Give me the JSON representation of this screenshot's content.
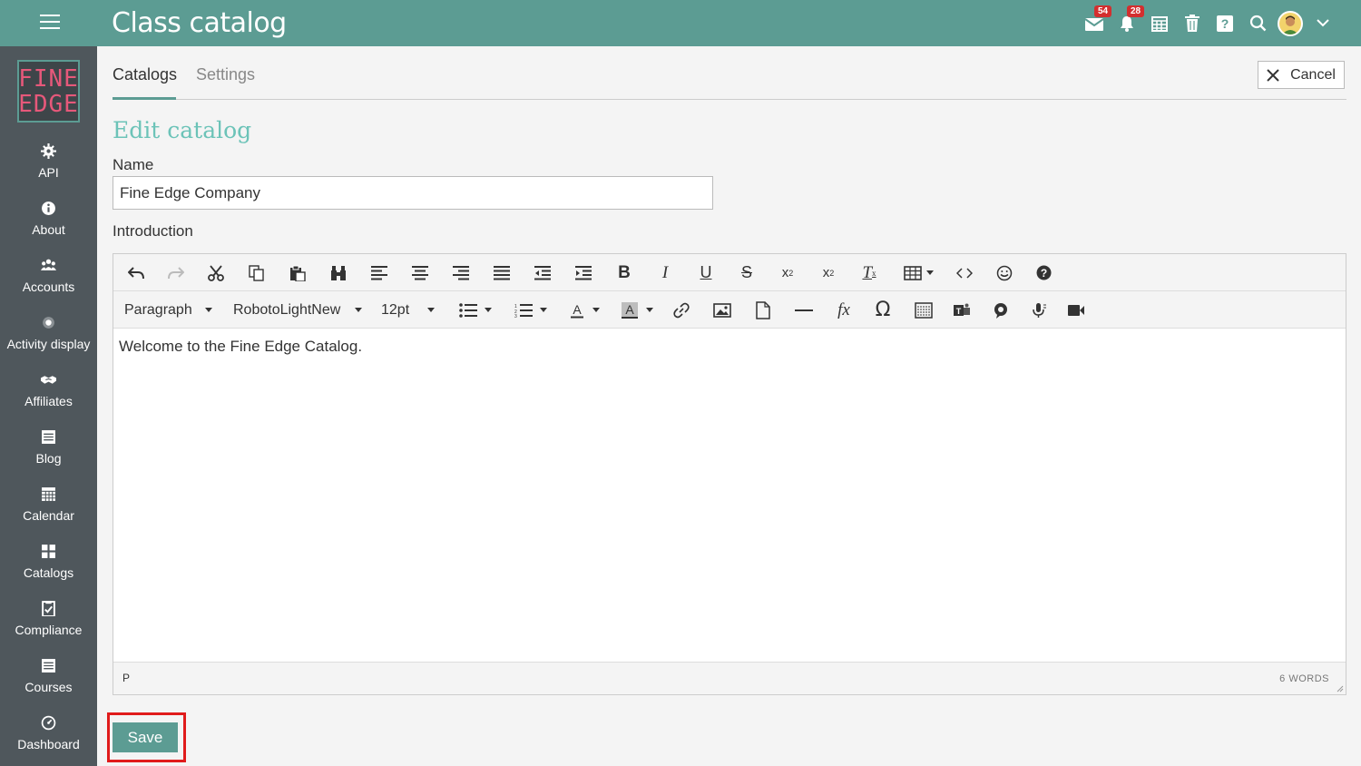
{
  "app": {
    "title": "Class catalog"
  },
  "topbar": {
    "mail_badge": "54",
    "bell_badge": "28",
    "icons": [
      "menu-icon",
      "mail-icon",
      "bell-icon",
      "calendar-icon",
      "trash-icon",
      "help-icon",
      "search-icon",
      "avatar",
      "chevron-down-icon"
    ]
  },
  "sidebar": {
    "logo_line1": "FINE",
    "logo_line2": "EDGE",
    "items": [
      {
        "label": "API",
        "icon": "gear-icon"
      },
      {
        "label": "About",
        "icon": "info-icon"
      },
      {
        "label": "Accounts",
        "icon": "users-icon"
      },
      {
        "label": "Activity display",
        "icon": "dot-icon"
      },
      {
        "label": "Affiliates",
        "icon": "handshake-icon"
      },
      {
        "label": "Blog",
        "icon": "blog-icon"
      },
      {
        "label": "Calendar",
        "icon": "calendar-icon"
      },
      {
        "label": "Catalogs",
        "icon": "grid-icon"
      },
      {
        "label": "Compliance",
        "icon": "checklist-icon"
      },
      {
        "label": "Courses",
        "icon": "courses-icon"
      },
      {
        "label": "Dashboard",
        "icon": "dashboard-icon"
      }
    ]
  },
  "tabs": [
    {
      "label": "Catalogs",
      "active": true
    },
    {
      "label": "Settings",
      "active": false
    }
  ],
  "cancel_label": "Cancel",
  "section_title": "Edit catalog",
  "form": {
    "name_label": "Name",
    "name_value": "Fine Edge Company",
    "intro_label": "Introduction"
  },
  "editor": {
    "format_select": "Paragraph",
    "font_select": "RobotoLightNew",
    "size_select": "12pt",
    "content": "Welcome to the Fine Edge Catalog.",
    "path": "P",
    "word_count": "6 WORDS"
  },
  "save_label": "Save",
  "colors": {
    "topbar": "#5c9c93",
    "sidebar": "#4f575c",
    "accent_title": "#6cc3b8",
    "highlight": "#e01b1b"
  }
}
